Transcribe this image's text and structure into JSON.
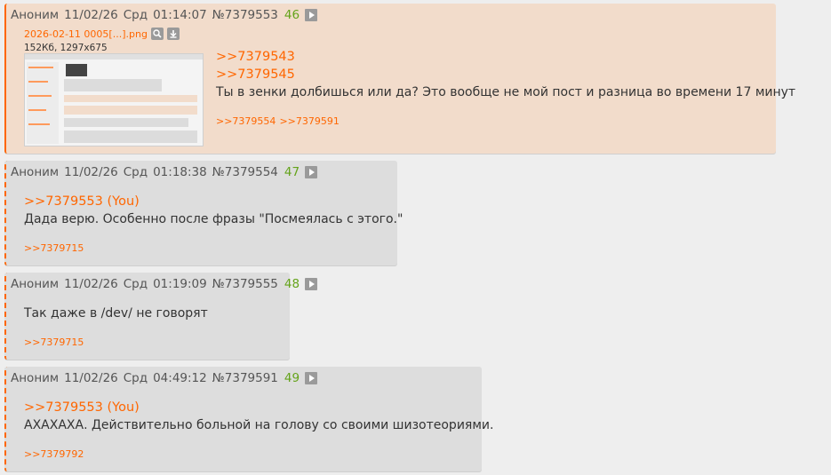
{
  "colors": {
    "accent": "#ff6600",
    "post_bg": "#dddddd",
    "highlight_bg": "#f2dccb",
    "page_bg": "#eeeeee",
    "number_green": "#64a31a"
  },
  "posts": [
    {
      "author": "Аноним",
      "date": "11/02/26",
      "day": "Срд",
      "time": "01:14:07",
      "id": "№7379553",
      "num": "46",
      "file": {
        "name": "2026-02-11 0005[...].png",
        "info": "152Кб, 1297x675"
      },
      "quotes": [
        ">>7379543",
        ">>7379545"
      ],
      "text": "Ты в зенки долбишься или да? Это вообще не мой пост и разница во времени 17 минут",
      "replies": [
        ">>7379554",
        ">>7379591"
      ]
    },
    {
      "author": "Аноним",
      "date": "11/02/26",
      "day": "Срд",
      "time": "01:18:38",
      "id": "№7379554",
      "num": "47",
      "quote": ">>7379553 (You)",
      "text": "Дада верю. Особенно после фразы \"Посмеялась с этого.\"",
      "replies": [
        ">>7379715"
      ]
    },
    {
      "author": "Аноним",
      "date": "11/02/26",
      "day": "Срд",
      "time": "01:19:09",
      "id": "№7379555",
      "num": "48",
      "text": "Так даже в /dev/ не говорят",
      "replies": [
        ">>7379715"
      ]
    },
    {
      "author": "Аноним",
      "date": "11/02/26",
      "day": "Срд",
      "time": "04:49:12",
      "id": "№7379591",
      "num": "49",
      "quote": ">>7379553 (You)",
      "text": "АХАХАХА. Действительно больной на голову со своими шизотеориями.",
      "replies": [
        ">>7379792"
      ]
    }
  ]
}
